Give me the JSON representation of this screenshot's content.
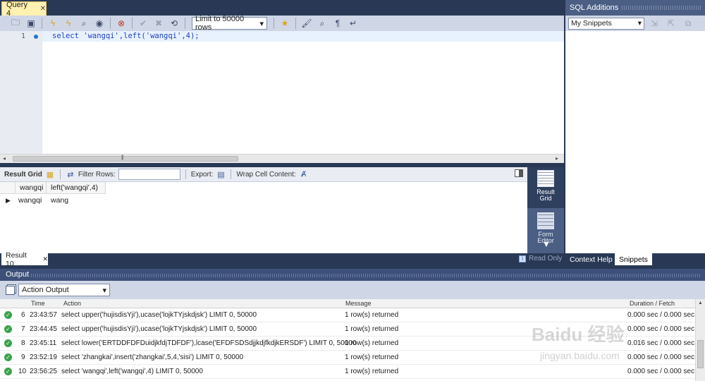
{
  "query_tab": {
    "label": "Query 4",
    "close": "✕"
  },
  "toolbar": {
    "limit_value": "Limit to 50000 rows"
  },
  "editor": {
    "line_number": "1",
    "code": "select 'wangqi',left('wangqi',4);"
  },
  "result_toolbar": {
    "grid_label": "Result Grid",
    "filter_label": "Filter Rows:",
    "filter_value": "",
    "export_label": "Export:",
    "wrap_label": "Wrap Cell Content:"
  },
  "result_grid": {
    "columns": [
      "wangqi",
      "left('wangqi',4)"
    ],
    "rows": [
      [
        "wangqi",
        "wang"
      ]
    ]
  },
  "view_switch": {
    "result_grid": "Result\nGrid",
    "form_editor": "Form\nEditor"
  },
  "result_tab": {
    "label": "Result 10",
    "close": "✕"
  },
  "read_only": "Read Only",
  "side_tabs": {
    "context_help": "Context Help",
    "snippets": "Snippets"
  },
  "additions": {
    "title": "SQL Additions",
    "snippets_select": "My Snippets"
  },
  "output": {
    "title": "Output",
    "select": "Action Output",
    "columns": {
      "time": "Time",
      "action": "Action",
      "message": "Message",
      "duration": "Duration / Fetch"
    },
    "rows": [
      {
        "n": "6",
        "time": "23:43:57",
        "action": "select upper('hujisdisYji'),ucase('lojkTYjskdjsk') LIMIT 0, 50000",
        "message": "1 row(s) returned",
        "duration": "0.000 sec / 0.000 sec"
      },
      {
        "n": "7",
        "time": "23:44:45",
        "action": "select upper('hujisdisYji'),ucase('lojkTYjskdjsk') LIMIT 0, 50000",
        "message": "1 row(s) returned",
        "duration": "0.000 sec / 0.000 sec"
      },
      {
        "n": "8",
        "time": "23:45:11",
        "action": "select lower('ERTDDFDFDuidjkfdjTDFDF'),lcase('EFDFSDSdjjkdjfkdjkERSDF') LIMIT 0, 50000",
        "message": "1 row(s) returned",
        "duration": "0.016 sec / 0.000 sec"
      },
      {
        "n": "9",
        "time": "23:52:19",
        "action": "select 'zhangkai',insert('zhangkai',5,4,'sisi') LIMIT 0, 50000",
        "message": "1 row(s) returned",
        "duration": "0.000 sec / 0.000 sec"
      },
      {
        "n": "10",
        "time": "23:56:25",
        "action": "select 'wangqi',left('wangqi',4) LIMIT 0, 50000",
        "message": "1 row(s) returned",
        "duration": "0.000 sec / 0.000 sec"
      }
    ]
  },
  "watermark": {
    "logo": "Baidu 经验",
    "url": "jingyan.baidu.com"
  }
}
